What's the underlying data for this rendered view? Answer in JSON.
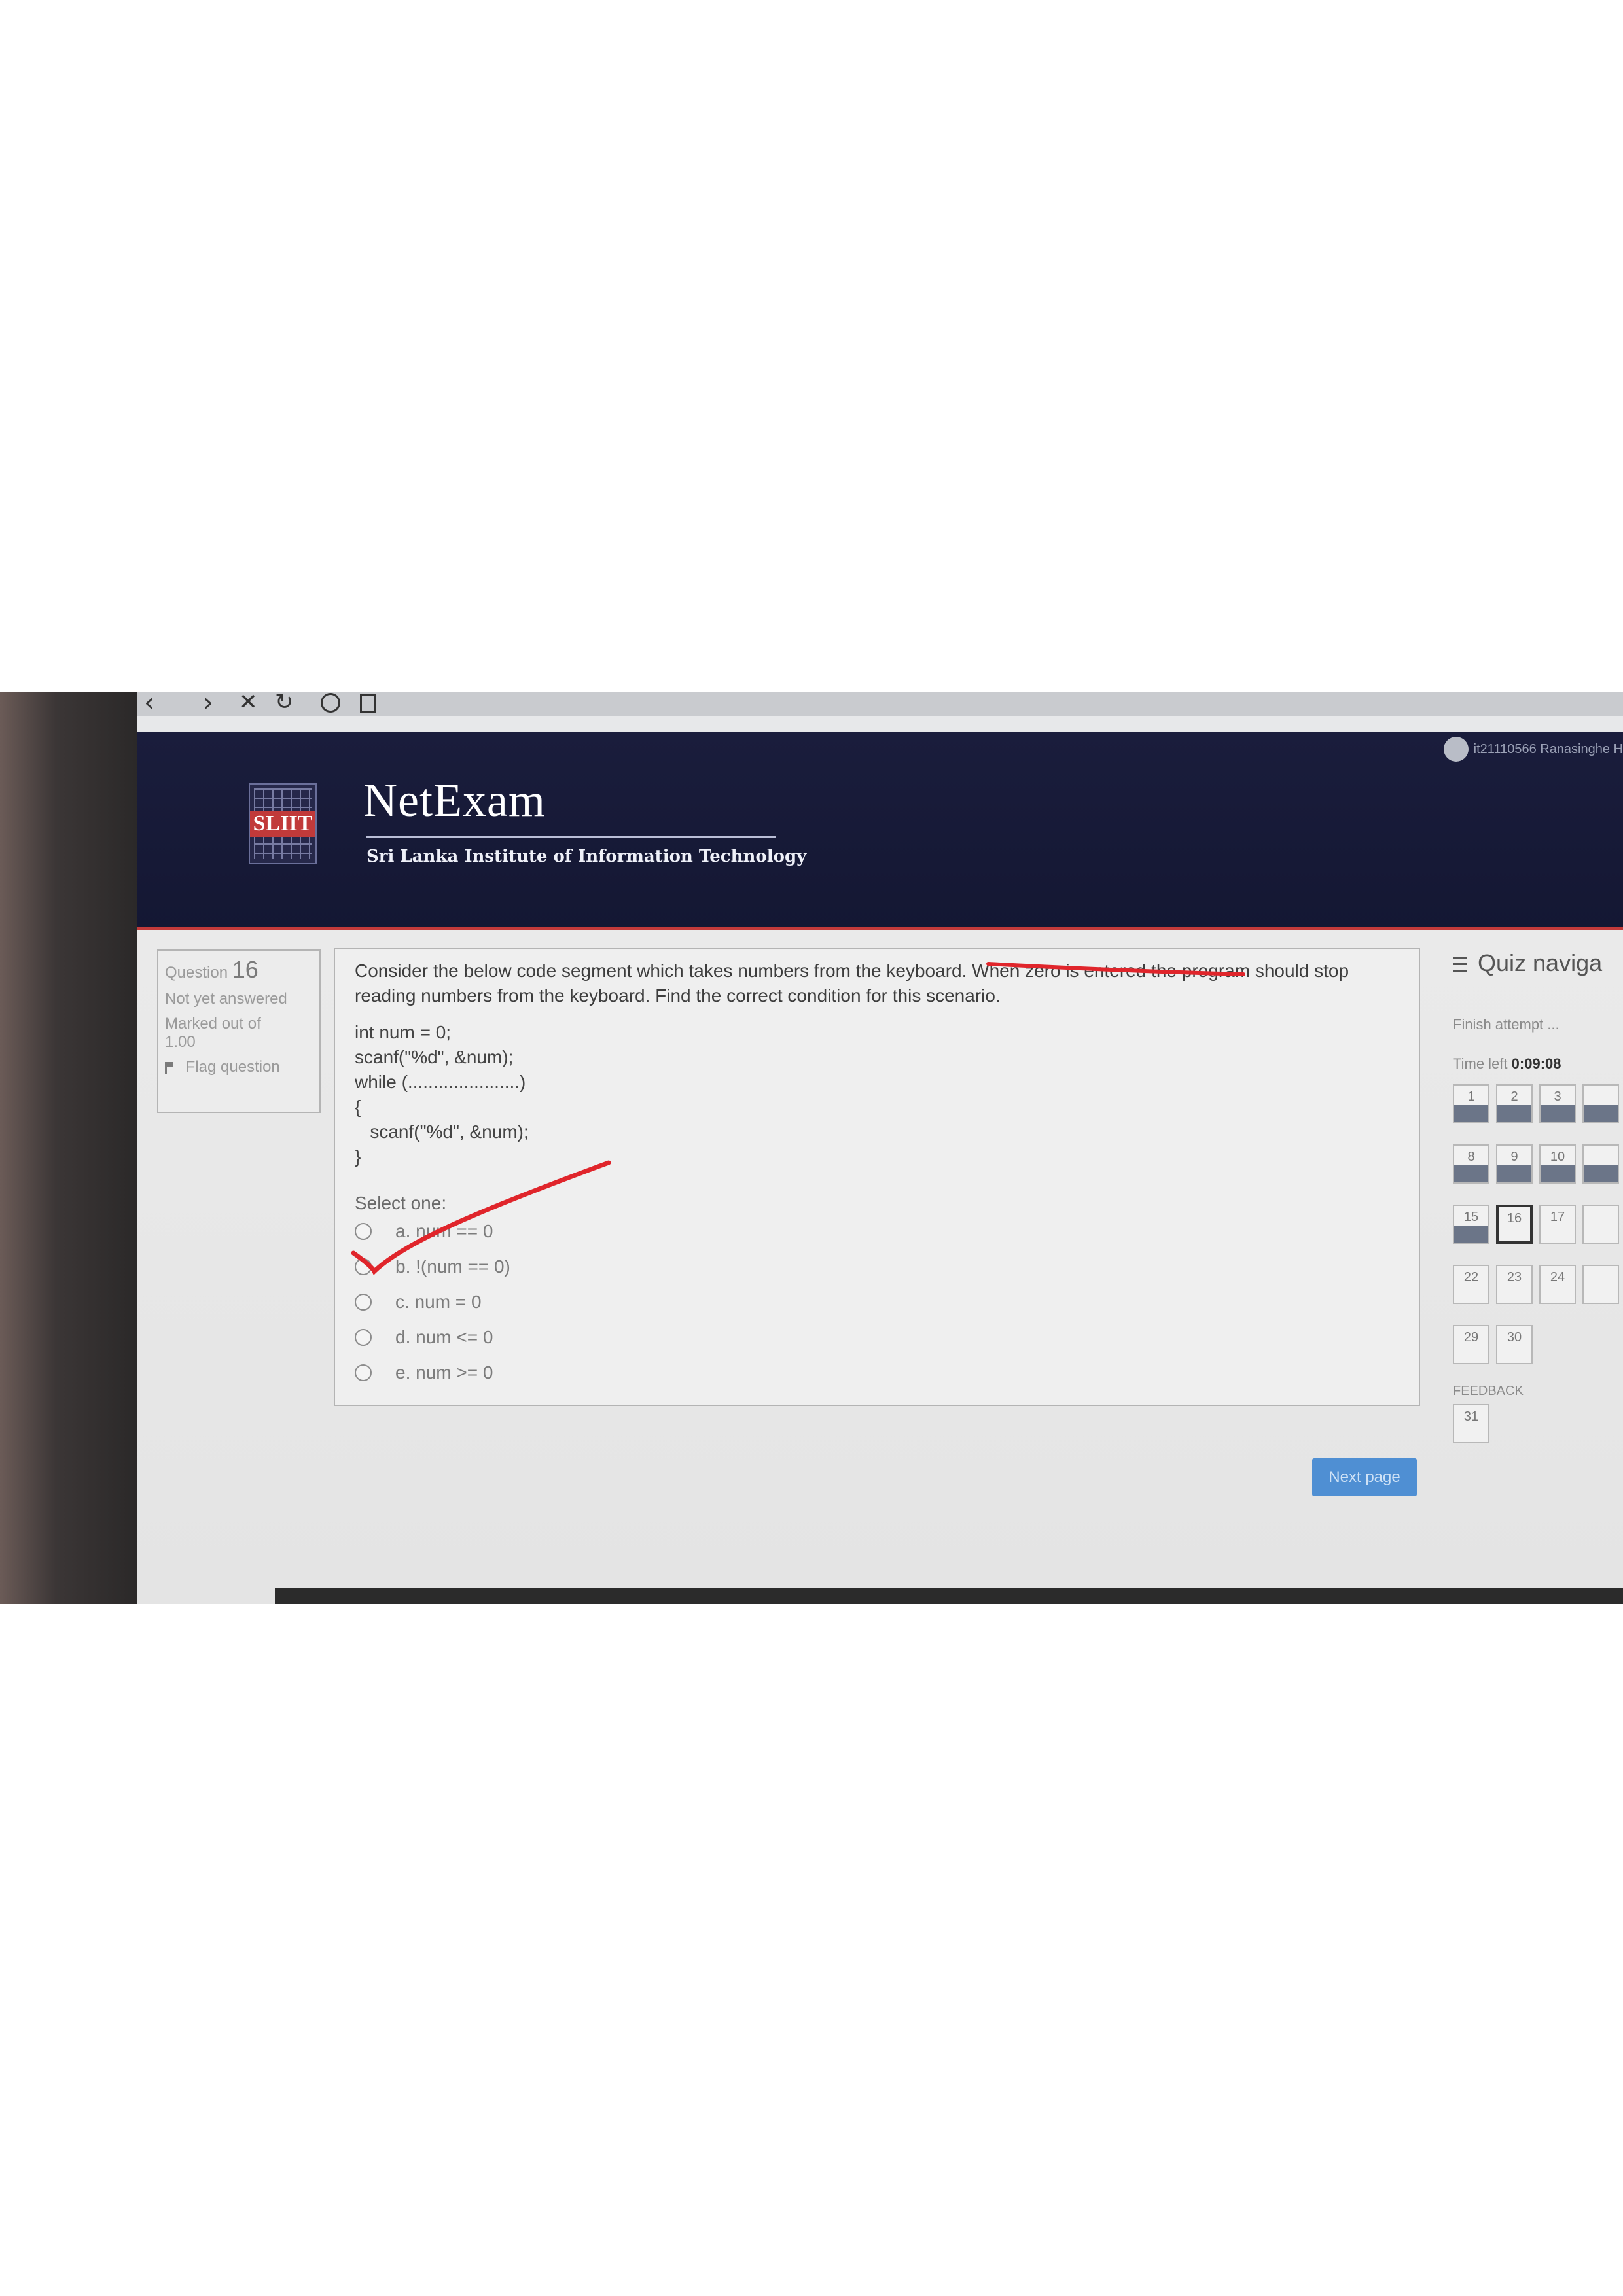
{
  "browser": {
    "back_glyph": "‹",
    "forward_glyph": "›",
    "close_glyph": "✕",
    "reload_glyph": "↻"
  },
  "user": {
    "name": "it21110566 Ranasinghe H"
  },
  "brand": {
    "logo_text": "SLIIT",
    "title": "NetExam",
    "subtitle": "Sri Lanka Institute of Information Technology"
  },
  "question_info": {
    "label": "Question",
    "number": "16",
    "status": "Not yet answered",
    "marked_label": "Marked out of",
    "marked_value": "1.00",
    "flag_label": "Flag question"
  },
  "question": {
    "text": "Consider the below code segment which takes numbers from the keyboard. When zero is entered the program should stop reading numbers from the keyboard. Find the correct condition for this scenario.",
    "code": [
      "int num = 0;",
      "scanf(\"%d\", &num);",
      "",
      "while (......................)",
      "{",
      "   scanf(\"%d\", &num);",
      "}"
    ],
    "select_label": "Select one:",
    "options": [
      "a. num == 0",
      "b. !(num == 0)",
      "c. num = 0",
      "d. num <= 0",
      "e. num >= 0"
    ]
  },
  "buttons": {
    "next_page": "Next page"
  },
  "quiz_nav": {
    "title": "Quiz naviga",
    "finish_attempt": "Finish attempt ...",
    "time_left_label": "Time left",
    "time_left_value": "0:09:08",
    "cells": [
      {
        "n": "1",
        "answered": true
      },
      {
        "n": "2",
        "answered": true
      },
      {
        "n": "3",
        "answered": true
      },
      {
        "n": "",
        "answered": true
      },
      {
        "n": "8",
        "answered": true
      },
      {
        "n": "9",
        "answered": true
      },
      {
        "n": "10",
        "answered": true
      },
      {
        "n": "",
        "answered": true
      },
      {
        "n": "15",
        "answered": true
      },
      {
        "n": "16",
        "answered": false,
        "current": true
      },
      {
        "n": "17",
        "answered": false
      },
      {
        "n": "",
        "answered": false
      },
      {
        "n": "22",
        "answered": false
      },
      {
        "n": "23",
        "answered": false
      },
      {
        "n": "24",
        "answered": false
      },
      {
        "n": "",
        "answered": false
      },
      {
        "n": "29",
        "answered": false
      },
      {
        "n": "30",
        "answered": false
      }
    ],
    "feedback_label": "FEEDBACK",
    "feedback_cells": [
      "31"
    ]
  },
  "colors": {
    "header_bg": "#1a1d3c",
    "accent_red": "#e0252b",
    "next_button": "#4f8fd3"
  }
}
